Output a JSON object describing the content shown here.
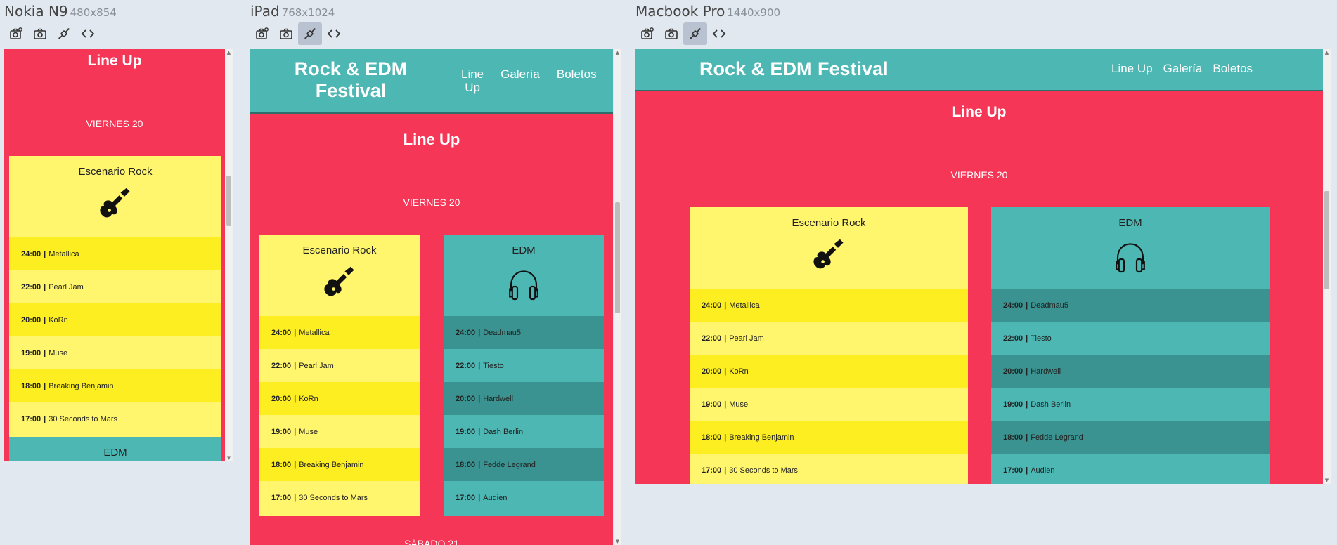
{
  "devices": [
    {
      "name": "Nokia N9",
      "size": "480x854"
    },
    {
      "name": "iPad",
      "size": "768x1024"
    },
    {
      "name": "Macbook Pro",
      "size": "1440x900"
    }
  ],
  "site": {
    "brand": "Rock & EDM Festival",
    "brand_line1": "Rock & EDM",
    "brand_line2": "Festival",
    "nav": [
      "Line Up",
      "Galería",
      "Boletos"
    ],
    "nav_lineup_1": "Line",
    "nav_lineup_2": "Up",
    "section_title": "Line Up",
    "day": "VIERNES 20",
    "next_day_partial": "SÁBADO 21",
    "stages": [
      {
        "name": "Escenario Rock",
        "icon": "guitar-icon",
        "acts": [
          {
            "time": "24:00",
            "artist": "Metallica"
          },
          {
            "time": "22:00",
            "artist": "Pearl Jam"
          },
          {
            "time": "20:00",
            "artist": "KoRn"
          },
          {
            "time": "19:00",
            "artist": "Muse"
          },
          {
            "time": "18:00",
            "artist": "Breaking Benjamin"
          },
          {
            "time": "17:00",
            "artist": "30 Seconds to Mars"
          }
        ]
      },
      {
        "name": "EDM",
        "icon": "headphones-icon",
        "acts": [
          {
            "time": "24:00",
            "artist": "Deadmau5"
          },
          {
            "time": "22:00",
            "artist": "Tiesto"
          },
          {
            "time": "20:00",
            "artist": "Hardwell"
          },
          {
            "time": "19:00",
            "artist": "Dash Berlin"
          },
          {
            "time": "18:00",
            "artist": "Fedde Legrand"
          },
          {
            "time": "17:00",
            "artist": "Audien"
          }
        ]
      }
    ]
  },
  "colors": {
    "page_bg": "#e1e8f0",
    "site_red": "#f53656",
    "teal": "#4db7b4",
    "teal_dark": "#3a9390",
    "yellow": "#fff66e",
    "yellow_strong": "#fdee21"
  }
}
